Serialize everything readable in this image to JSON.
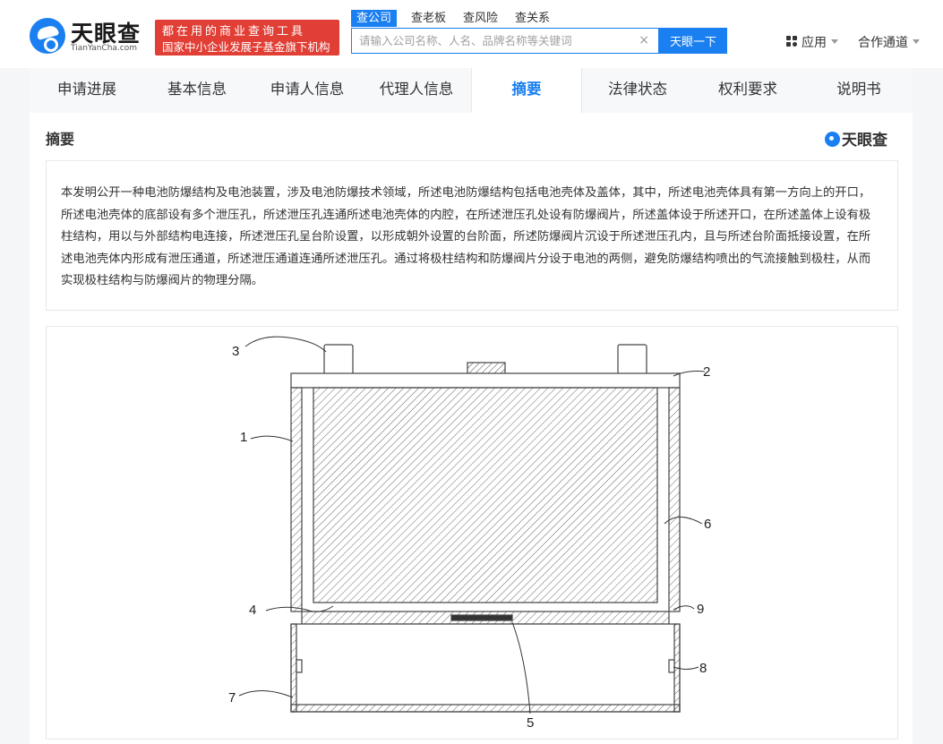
{
  "header": {
    "logo_text": "天眼查",
    "logo_sub": "TianYanCha.com",
    "slogan_line1": "都在用的商业查询工具",
    "slogan_line2": "国家中小企业发展子基金旗下机构",
    "search_tabs": [
      "查公司",
      "查老板",
      "查风险",
      "查关系"
    ],
    "search_placeholder": "请输入公司名称、人名、品牌名称等关键词",
    "clear_symbol": "×",
    "search_button": "天眼一下",
    "apps_label": "应用",
    "partner_label": "合作通道"
  },
  "tabs": [
    "申请进展",
    "基本信息",
    "申请人信息",
    "代理人信息",
    "摘要",
    "法律状态",
    "权利要求",
    "说明书"
  ],
  "active_tab": "摘要",
  "section": {
    "title": "摘要",
    "brand": "天眼查"
  },
  "abstract_text": "本发明公开一种电池防爆结构及电池装置，涉及电池防爆技术领域，所述电池防爆结构包括电池壳体及盖体，其中，所述电池壳体具有第一方向上的开口，所述电池壳体的底部设有多个泄压孔，所述泄压孔连通所述电池壳体的内腔，在所述泄压孔处设有防爆阀片，所述盖体设于所述开口，在所述盖体上设有极柱结构，用以与外部结构电连接，所述泄压孔呈台阶设置，以形成朝外设置的台阶面，所述防爆阀片沉设于所述泄压孔内，且与所述台阶面抵接设置，在所述电池壳体内形成有泄压通道，所述泄压通道连通所述泄压孔。通过将极柱结构和防爆阀片分设于电池的两侧，避免防爆结构喷出的气流接触到极柱，从而实现极柱结构与防爆阀片的物理分隔。",
  "figure_labels": [
    "1",
    "2",
    "3",
    "4",
    "5",
    "6",
    "7",
    "8",
    "9"
  ],
  "colors": {
    "brand_blue": "#1a7ff0",
    "slogan_red": "#e13f36"
  }
}
